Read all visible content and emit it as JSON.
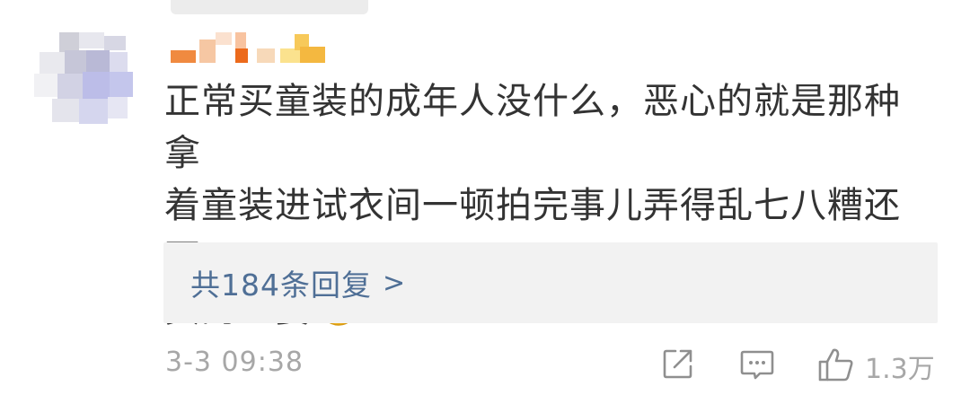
{
  "comment": {
    "text_line1": "正常买童装的成年人没什么，恶心的就是那种拿",
    "text_line2": "着童装进试衣间一顿拍完事儿弄得乱七八糟还不",
    "text_line3": "买的巨婴",
    "emoji_icon": "smile-emoji-icon"
  },
  "replies": {
    "label": "共184条回复",
    "arrow": ">"
  },
  "footer": {
    "timestamp": "3-3 09:38",
    "like_count": "1.3万",
    "share_icon": "share-icon",
    "comment_icon": "comment-icon",
    "like_icon": "thumbs-up-icon"
  },
  "colors": {
    "text": "#333333",
    "link": "#4f6f96",
    "meta": "#a7a7a7",
    "reply_bg": "#f2f2f2"
  }
}
